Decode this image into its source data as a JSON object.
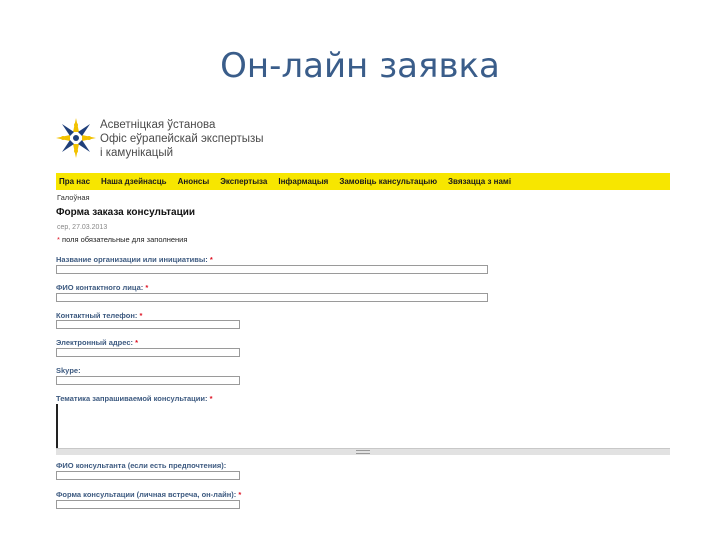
{
  "slide": {
    "title": "Он-лайн заявка"
  },
  "logo": {
    "line1": "Асветніцкая ўстанова",
    "line2": "Офіс еўрапейскай экспертызы",
    "line3": "і камунікацый"
  },
  "nav": {
    "items": [
      "Пра нас",
      "Наша дзейнасць",
      "Анонсы",
      "Экспертыза",
      "Інфармацыя",
      "Замовіць кансультацыю",
      "Звязацца з намі"
    ]
  },
  "breadcrumb": "Галоўная",
  "form": {
    "title": "Форма заказа консультации",
    "meta": "сер, 27.03.2013",
    "required_note": "поля обязательные для заполнения",
    "required_mark": "*",
    "fields": [
      {
        "label": "Название организации или инициативы:",
        "required": true,
        "value": ""
      },
      {
        "label": "ФИО контактного лица:",
        "required": true,
        "value": ""
      },
      {
        "label": "Контактный телефон:",
        "required": true,
        "value": ""
      },
      {
        "label": "Электронный адрес:",
        "required": true,
        "value": ""
      },
      {
        "label": "Skype:",
        "required": false,
        "value": ""
      },
      {
        "label": "Тематика запрашиваемой консультации:",
        "required": true,
        "value": ""
      },
      {
        "label": "ФИО консультанта (если есть предпочтения):",
        "required": false,
        "value": ""
      },
      {
        "label": "Форма консультации (личная встреча, он-лайн):",
        "required": true,
        "value": ""
      }
    ]
  },
  "colors": {
    "title": "#3a5d8a",
    "nav_background": "#f7e600",
    "label": "#3d5a80",
    "required": "#d12222"
  }
}
